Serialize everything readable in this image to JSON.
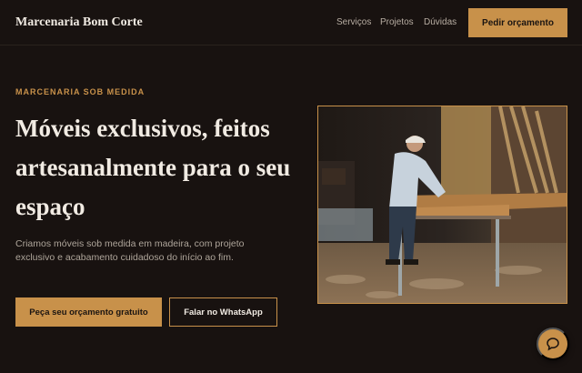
{
  "header": {
    "brand": "Marcenaria Bom Corte",
    "nav": [
      "Serviços",
      "Projetos",
      "Dúvidas"
    ],
    "cta": "Pedir orçamento"
  },
  "hero": {
    "eyebrow": "MARCENARIA SOB MEDIDA",
    "headline": "Móveis exclusivos, feitos artesanalmente para o seu espaço",
    "lead": "Criamos móveis sob medida em madeira, com projeto exclusivo e acabamento cuidadoso do início ao fim.",
    "primary_button": "Peça seu orçamento gratuito",
    "secondary_button": "Falar no WhatsApp"
  },
  "colors": {
    "background": "#181210",
    "accent": "#c8914a",
    "text": "#f1ebe3"
  },
  "icons": {
    "chat": "chat-bubble-icon"
  }
}
